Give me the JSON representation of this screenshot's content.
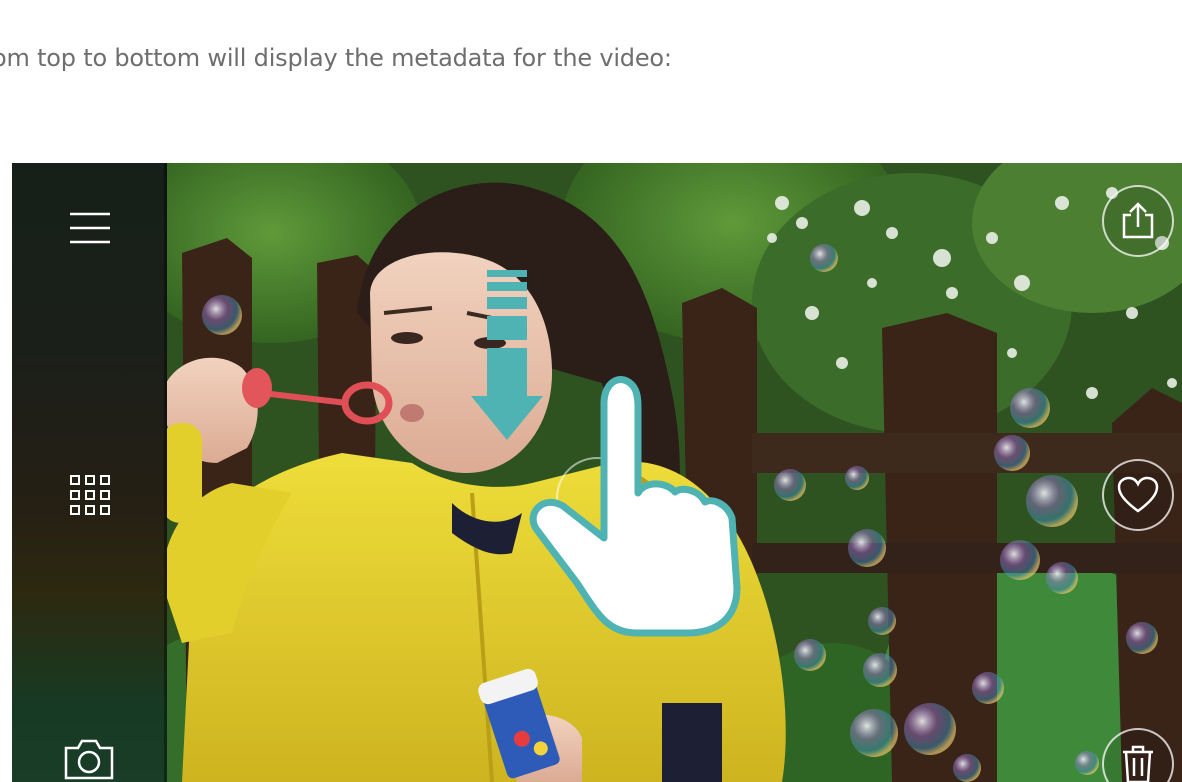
{
  "caption": "om top to bottom will display the metadata for the video:",
  "viewer": {
    "sidebar": {
      "items": [
        {
          "icon": "menu-icon"
        },
        {
          "icon": "grid-icon"
        },
        {
          "icon": "camera-icon"
        }
      ]
    },
    "actions": [
      {
        "icon": "share-icon"
      },
      {
        "icon": "heart-icon"
      },
      {
        "icon": "trash-icon"
      }
    ],
    "gesture": {
      "icon": "swipe-down-hand-icon",
      "direction": "down"
    },
    "colors": {
      "accent": "#4fb3b3",
      "sidebar": "#1b1f1a",
      "raincoat": "#e3cf2b"
    }
  }
}
